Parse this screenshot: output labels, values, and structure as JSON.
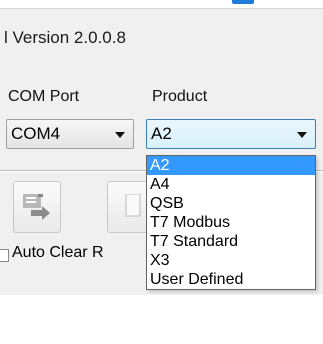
{
  "window": {
    "title": "l Version 2.0.0.8"
  },
  "com_port": {
    "label": "COM Port",
    "value": "COM4"
  },
  "product": {
    "label": "Product",
    "value": "A2",
    "options": [
      "A2",
      "A4",
      "QSB",
      "T7 Modbus",
      "T7 Standard",
      "X3",
      "User Defined"
    ],
    "highlighted_option": "A2"
  },
  "toolbar": {
    "buttons": [
      {
        "icon": "list-arrow-icon"
      },
      {
        "icon": "document-icon"
      }
    ]
  },
  "options": {
    "auto_clear_label": "Auto Clear R",
    "auto_clear_checked": false
  },
  "colors": {
    "selection": "#3399ff",
    "accent": "#1f7bd8",
    "window_bg": "#f0f0f0"
  }
}
